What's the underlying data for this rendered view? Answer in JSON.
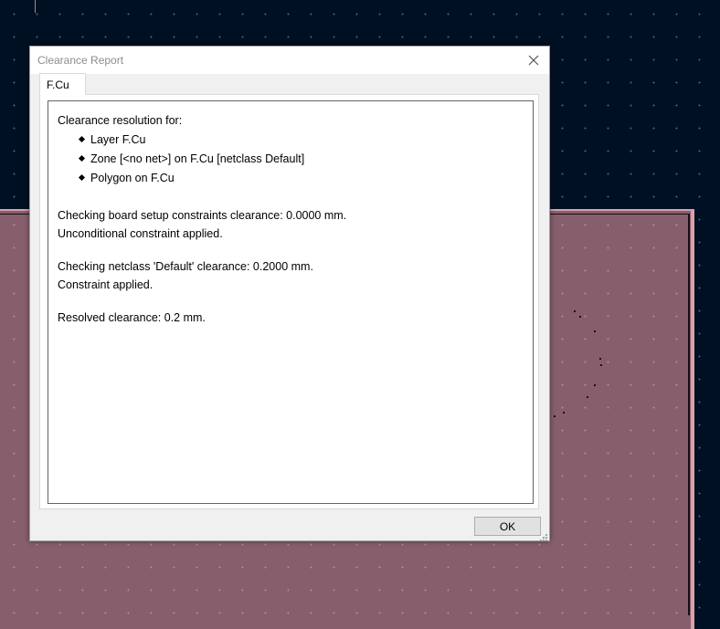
{
  "dialog": {
    "title": "Clearance Report",
    "tab_label": "F.Cu",
    "ok_label": "OK"
  },
  "report": {
    "heading": "Clearance resolution for:",
    "items": [
      "Layer F.Cu",
      "Zone [<no net>] on F.Cu [netclass Default]",
      "Polygon on F.Cu"
    ],
    "board_check": "Checking board setup constraints clearance: 0.0000 mm.",
    "board_result": "Unconditional constraint applied.",
    "netclass_check": "Checking netclass 'Default' clearance: 0.2000 mm.",
    "netclass_result": "Constraint applied.",
    "resolved": "Resolved clearance: 0.2 mm."
  },
  "icons": {
    "close": "close-icon",
    "bullet": "diamond-bullet-icon",
    "resize": "resize-grip-icon"
  },
  "colors": {
    "canvas_bg": "#001023",
    "zone_fill": "#875f6c",
    "zone_outline": "#d9a0ac"
  }
}
